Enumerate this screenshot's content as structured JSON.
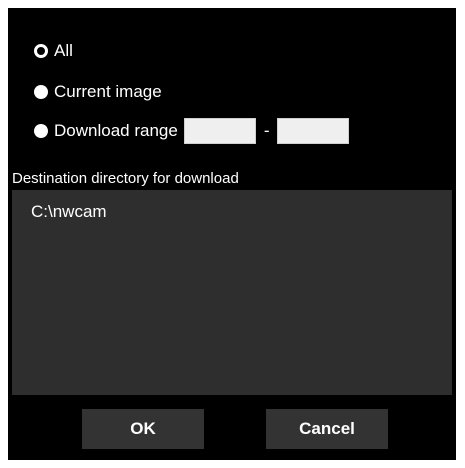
{
  "download_options": {
    "all_label": "All",
    "current_label": "Current image",
    "range_label": "Download range",
    "range_from_value": "",
    "range_to_value": "",
    "range_separator": "-",
    "selected": "All"
  },
  "destination": {
    "label": "Destination directory for download",
    "path": "C:\\nwcam"
  },
  "buttons": {
    "ok_label": "OK",
    "cancel_label": "Cancel"
  }
}
